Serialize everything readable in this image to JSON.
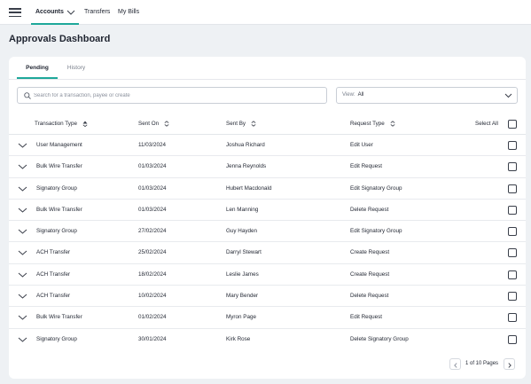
{
  "topnav": {
    "items": [
      {
        "label": "Accounts",
        "active": true,
        "dropdown": true
      },
      {
        "label": "Transfers"
      },
      {
        "label": "My Bills"
      }
    ]
  },
  "page": {
    "title": "Approvals Dashboard"
  },
  "tabs": [
    {
      "label": "Pending",
      "active": true
    },
    {
      "label": "History"
    }
  ],
  "search": {
    "placeholder": "Search for a transaction, payee or create",
    "value": ""
  },
  "view": {
    "label": "View:",
    "value": "All"
  },
  "table": {
    "headers": {
      "type": "Transaction Type",
      "sent_on": "Sent On",
      "sent_by": "Sent By",
      "request_type": "Request Type",
      "select_all": "Select All"
    },
    "rows": [
      {
        "type": "User Management",
        "sent_on": "11/03/2024",
        "sent_by": "Joshua Richard",
        "request": "Edit User"
      },
      {
        "type": "Bulk Wire Transfer",
        "sent_on": "01/03/2024",
        "sent_by": "Jenna Reynolds",
        "request": "Edit Request"
      },
      {
        "type": "Signatory Group",
        "sent_on": "01/03/2024",
        "sent_by": "Hubert Macdonald",
        "request": "Edit Signatory Group"
      },
      {
        "type": "Bulk Wire Transfer",
        "sent_on": "01/03/2024",
        "sent_by": "Len Manning",
        "request": "Delete Request"
      },
      {
        "type": "Signatory Group",
        "sent_on": "27/02/2024",
        "sent_by": "Guy Hayden",
        "request": "Edit Signatory Group"
      },
      {
        "type": "ACH Transfer",
        "sent_on": "25/02/2024",
        "sent_by": "Darryl Stewart",
        "request": "Create Request"
      },
      {
        "type": "ACH Transfer",
        "sent_on": "18/02/2024",
        "sent_by": "Leslie James",
        "request": "Create Request"
      },
      {
        "type": "ACH Transfer",
        "sent_on": "10/02/2024",
        "sent_by": "Mary Bender",
        "request": "Delete Request"
      },
      {
        "type": "Bulk Wire Transfer",
        "sent_on": "01/02/2024",
        "sent_by": "Myron Page",
        "request": "Edit Request"
      },
      {
        "type": "Signatory Group",
        "sent_on": "30/01/2024",
        "sent_by": "Kirk Rose",
        "request": "Delete Signatory Group"
      }
    ]
  },
  "pagination": {
    "text": "1 of 10 Pages",
    "current": 1,
    "total": 10
  },
  "colors": {
    "accent": "#1ea89a",
    "background": "#eef1f4",
    "card": "#ffffff",
    "text": "#1f2430",
    "muted": "#7a808c"
  }
}
